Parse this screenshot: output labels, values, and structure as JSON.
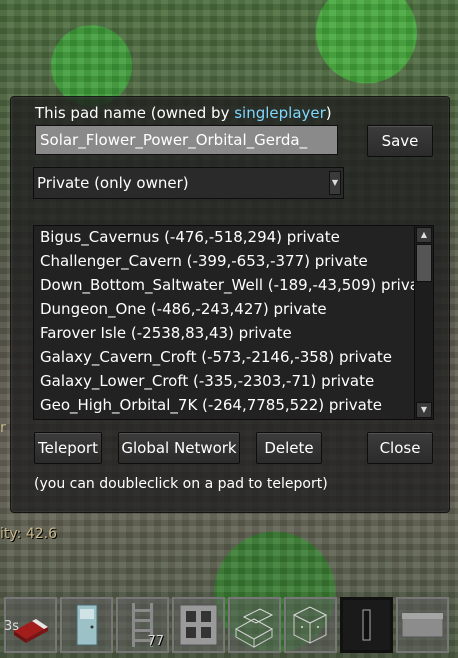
{
  "dialog": {
    "owner_prefix": "This pad name (owned by ",
    "owner_name": "singleplayer",
    "owner_suffix": ")",
    "pad_name_value": "Solar_Flower_Power_Orbital_Gerda_",
    "save_label": "Save",
    "visibility_selected": "Private (only owner)",
    "pads": [
      "Bigus_Cavernus (-476,-518,294) private",
      "Challenger_Cavern (-399,-653,-377) private",
      "Down_Bottom_Saltwater_Well (-189,-43,509) private",
      "Dungeon_One (-486,-243,427) private",
      "Farover Isle (-2538,83,43) private",
      "Galaxy_Cavern_Croft (-573,-2146,-358) private",
      "Galaxy_Lower_Croft (-335,-2303,-71) private",
      "Geo_High_Orbital_7K (-264,7785,522) private"
    ],
    "teleport_label": "Teleport",
    "global_network_label": "Global Network",
    "delete_label": "Delete",
    "close_label": "Close",
    "hint": "(you can doubleclick on a pad to teleport)"
  },
  "hud": {
    "left_fragment": "r",
    "speed_text": "ity: 42.6",
    "slot0_text": "3s",
    "slot_count": "77"
  },
  "icons": [
    "red-bed-icon",
    "door-icon",
    "ladder-icon",
    "stone-block-icon",
    "glass-stair-icon",
    "glass-block-icon",
    "torch-icon",
    "metal-slab-icon"
  ]
}
